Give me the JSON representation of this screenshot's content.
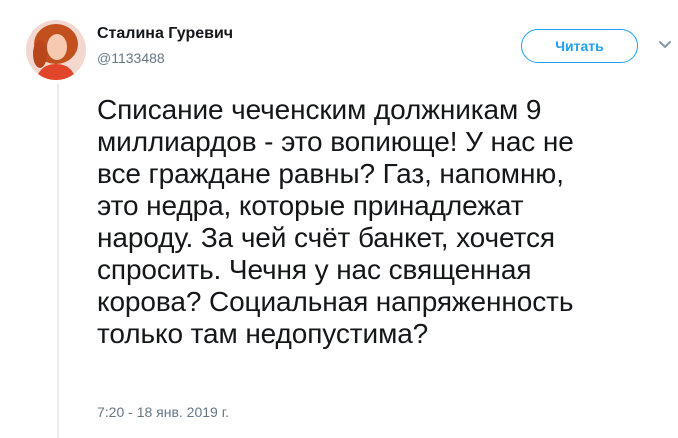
{
  "author": {
    "name": "Сталина Гуревич",
    "handle": "@1133488"
  },
  "follow_button": {
    "label": "Читать"
  },
  "tweet": {
    "text": "Списание чеченским должникам 9\nмиллиардов - это вопиюще! У нас не\nвсе граждане равны? Газ, напомню,\nэто недра, которые принадлежат\nнароду. За чей счёт банкет, хочется\nспросить. Чечня у нас священная\nкорова? Социальная напряженность\nтолько там недопустима?",
    "timestamp": "7:20 - 18 янв. 2019 г."
  },
  "colors": {
    "accent": "#1da1f2",
    "secondary_text": "#657786",
    "primary_text": "#14171a"
  },
  "icons": {
    "caret": "chevron-down-icon"
  }
}
